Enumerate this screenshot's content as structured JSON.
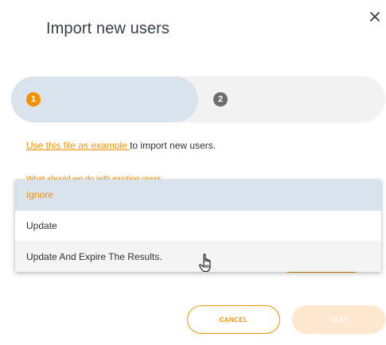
{
  "dialog": {
    "title": "Import new users",
    "close_icon": "close-icon"
  },
  "stepper": {
    "steps": [
      {
        "number": "1",
        "active": true
      },
      {
        "number": "2",
        "active": false
      }
    ]
  },
  "example": {
    "link_text": "Use this file as example ",
    "suffix_text": "to import new users."
  },
  "existing_users": {
    "label": "What should we do with existing users"
  },
  "dropdown": {
    "options": [
      {
        "label": "Ignore",
        "selected": true
      },
      {
        "label": "Update",
        "selected": false
      },
      {
        "label": "Update And Expire The Results.",
        "selected": false
      }
    ]
  },
  "footer": {
    "cancel_label": "CANCEL",
    "next_label": "NEXT"
  },
  "colors": {
    "accent": "#f39200",
    "step_active_bg": "#d9e3ec",
    "step_inactive_badge": "#6d6d6d",
    "next_disabled_bg": "#fde8cf"
  }
}
